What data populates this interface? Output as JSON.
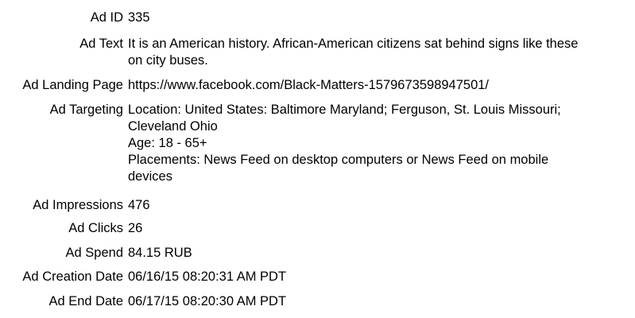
{
  "fields": {
    "ad_id": {
      "label": "Ad ID",
      "value": "335"
    },
    "ad_text": {
      "label": "Ad Text",
      "lines": [
        "It is an American history. African-American citizens sat behind signs like these",
        "on city buses."
      ]
    },
    "ad_landing_page": {
      "label": "Ad Landing Page",
      "value": "https://www.facebook.com/Black-Matters-1579673598947501/"
    },
    "ad_targeting": {
      "label": "Ad Targeting",
      "lines": [
        "Location: United States: Baltimore Maryland; Ferguson, St. Louis Missouri;",
        "Cleveland Ohio",
        "Age: 18 - 65+",
        "Placements: News Feed on desktop computers or News Feed on mobile",
        "devices"
      ]
    },
    "ad_impressions": {
      "label": "Ad Impressions",
      "value": "476"
    },
    "ad_clicks": {
      "label": "Ad Clicks",
      "value": "26"
    },
    "ad_spend": {
      "label": "Ad Spend",
      "value": "84.15 RUB"
    },
    "ad_creation_date": {
      "label": "Ad Creation Date",
      "value": "06/16/15 08:20:31 AM PDT"
    },
    "ad_end_date": {
      "label": "Ad End Date",
      "value": "06/17/15 08:20:30 AM PDT"
    }
  }
}
